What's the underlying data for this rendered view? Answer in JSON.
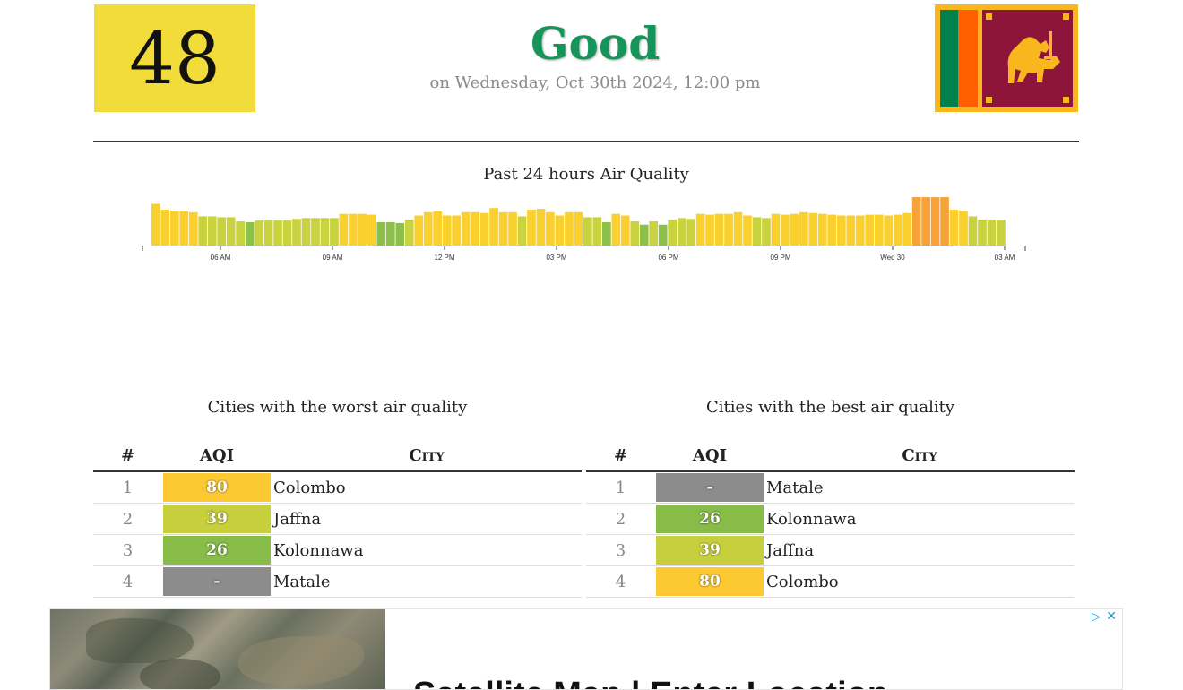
{
  "current": {
    "aqi": "48",
    "status": "Good",
    "date": "on Wednesday, Oct 30th 2024, 12:00 pm",
    "box_color": "#f2dc3a",
    "status_color": "#16955a"
  },
  "flag_icon": "sri-lanka-flag-icon",
  "chart_data": {
    "type": "bar",
    "title": "Past 24 hours Air Quality",
    "tick_labels": [
      "06 AM",
      "09 AM",
      "12 PM",
      "03 PM",
      "06 PM",
      "09 PM",
      "Wed 30",
      "03 AM"
    ],
    "values": [
      50,
      43,
      42,
      41,
      40,
      35,
      35,
      34,
      34,
      29,
      28,
      30,
      30,
      30,
      30,
      32,
      33,
      33,
      33,
      33,
      38,
      38,
      38,
      37,
      28,
      28,
      27,
      31,
      36,
      40,
      41,
      36,
      36,
      40,
      40,
      39,
      45,
      40,
      40,
      35,
      43,
      44,
      40,
      36,
      40,
      40,
      34,
      34,
      28,
      38,
      36,
      29,
      25,
      29,
      25,
      31,
      33,
      32,
      38,
      37,
      38,
      38,
      40,
      36,
      34,
      33,
      38,
      37,
      38,
      40,
      39,
      38,
      37,
      36,
      36,
      36,
      37,
      37,
      36,
      37,
      39,
      58,
      58,
      58,
      58,
      43,
      42,
      35,
      31,
      31,
      31
    ],
    "colors": {
      "green": "#8cc04a",
      "yellow_green": "#c9d33f",
      "yellow": "#fad02f",
      "orange": "#f7a23a"
    }
  },
  "worst": {
    "title": "Cities with the worst air quality",
    "headers": {
      "rank": "#",
      "aqi": "AQI",
      "city": "City"
    },
    "rows": [
      {
        "rank": "1",
        "aqi": "80",
        "city": "Colombo",
        "color": "#fcc932"
      },
      {
        "rank": "2",
        "aqi": "39",
        "city": "Jaffna",
        "color": "#c8cf3c"
      },
      {
        "rank": "3",
        "aqi": "26",
        "city": "Kolonnawa",
        "color": "#87bc48"
      },
      {
        "rank": "4",
        "aqi": "-",
        "city": "Matale",
        "color": "#8c8c8c"
      }
    ]
  },
  "best": {
    "title": "Cities with the best air quality",
    "headers": {
      "rank": "#",
      "aqi": "AQI",
      "city": "City"
    },
    "rows": [
      {
        "rank": "1",
        "aqi": "-",
        "city": "Matale",
        "color": "#8c8c8c"
      },
      {
        "rank": "2",
        "aqi": "26",
        "city": "Kolonnawa",
        "color": "#87bc48"
      },
      {
        "rank": "3",
        "aqi": "39",
        "city": "Jaffna",
        "color": "#c8cf3c"
      },
      {
        "rank": "4",
        "aqi": "80",
        "city": "Colombo",
        "color": "#fcc932"
      }
    ]
  },
  "ad": {
    "text": "Satellite Map | Enter Location",
    "choices_icon": "ad-choices-icon",
    "close_label": "✕"
  }
}
